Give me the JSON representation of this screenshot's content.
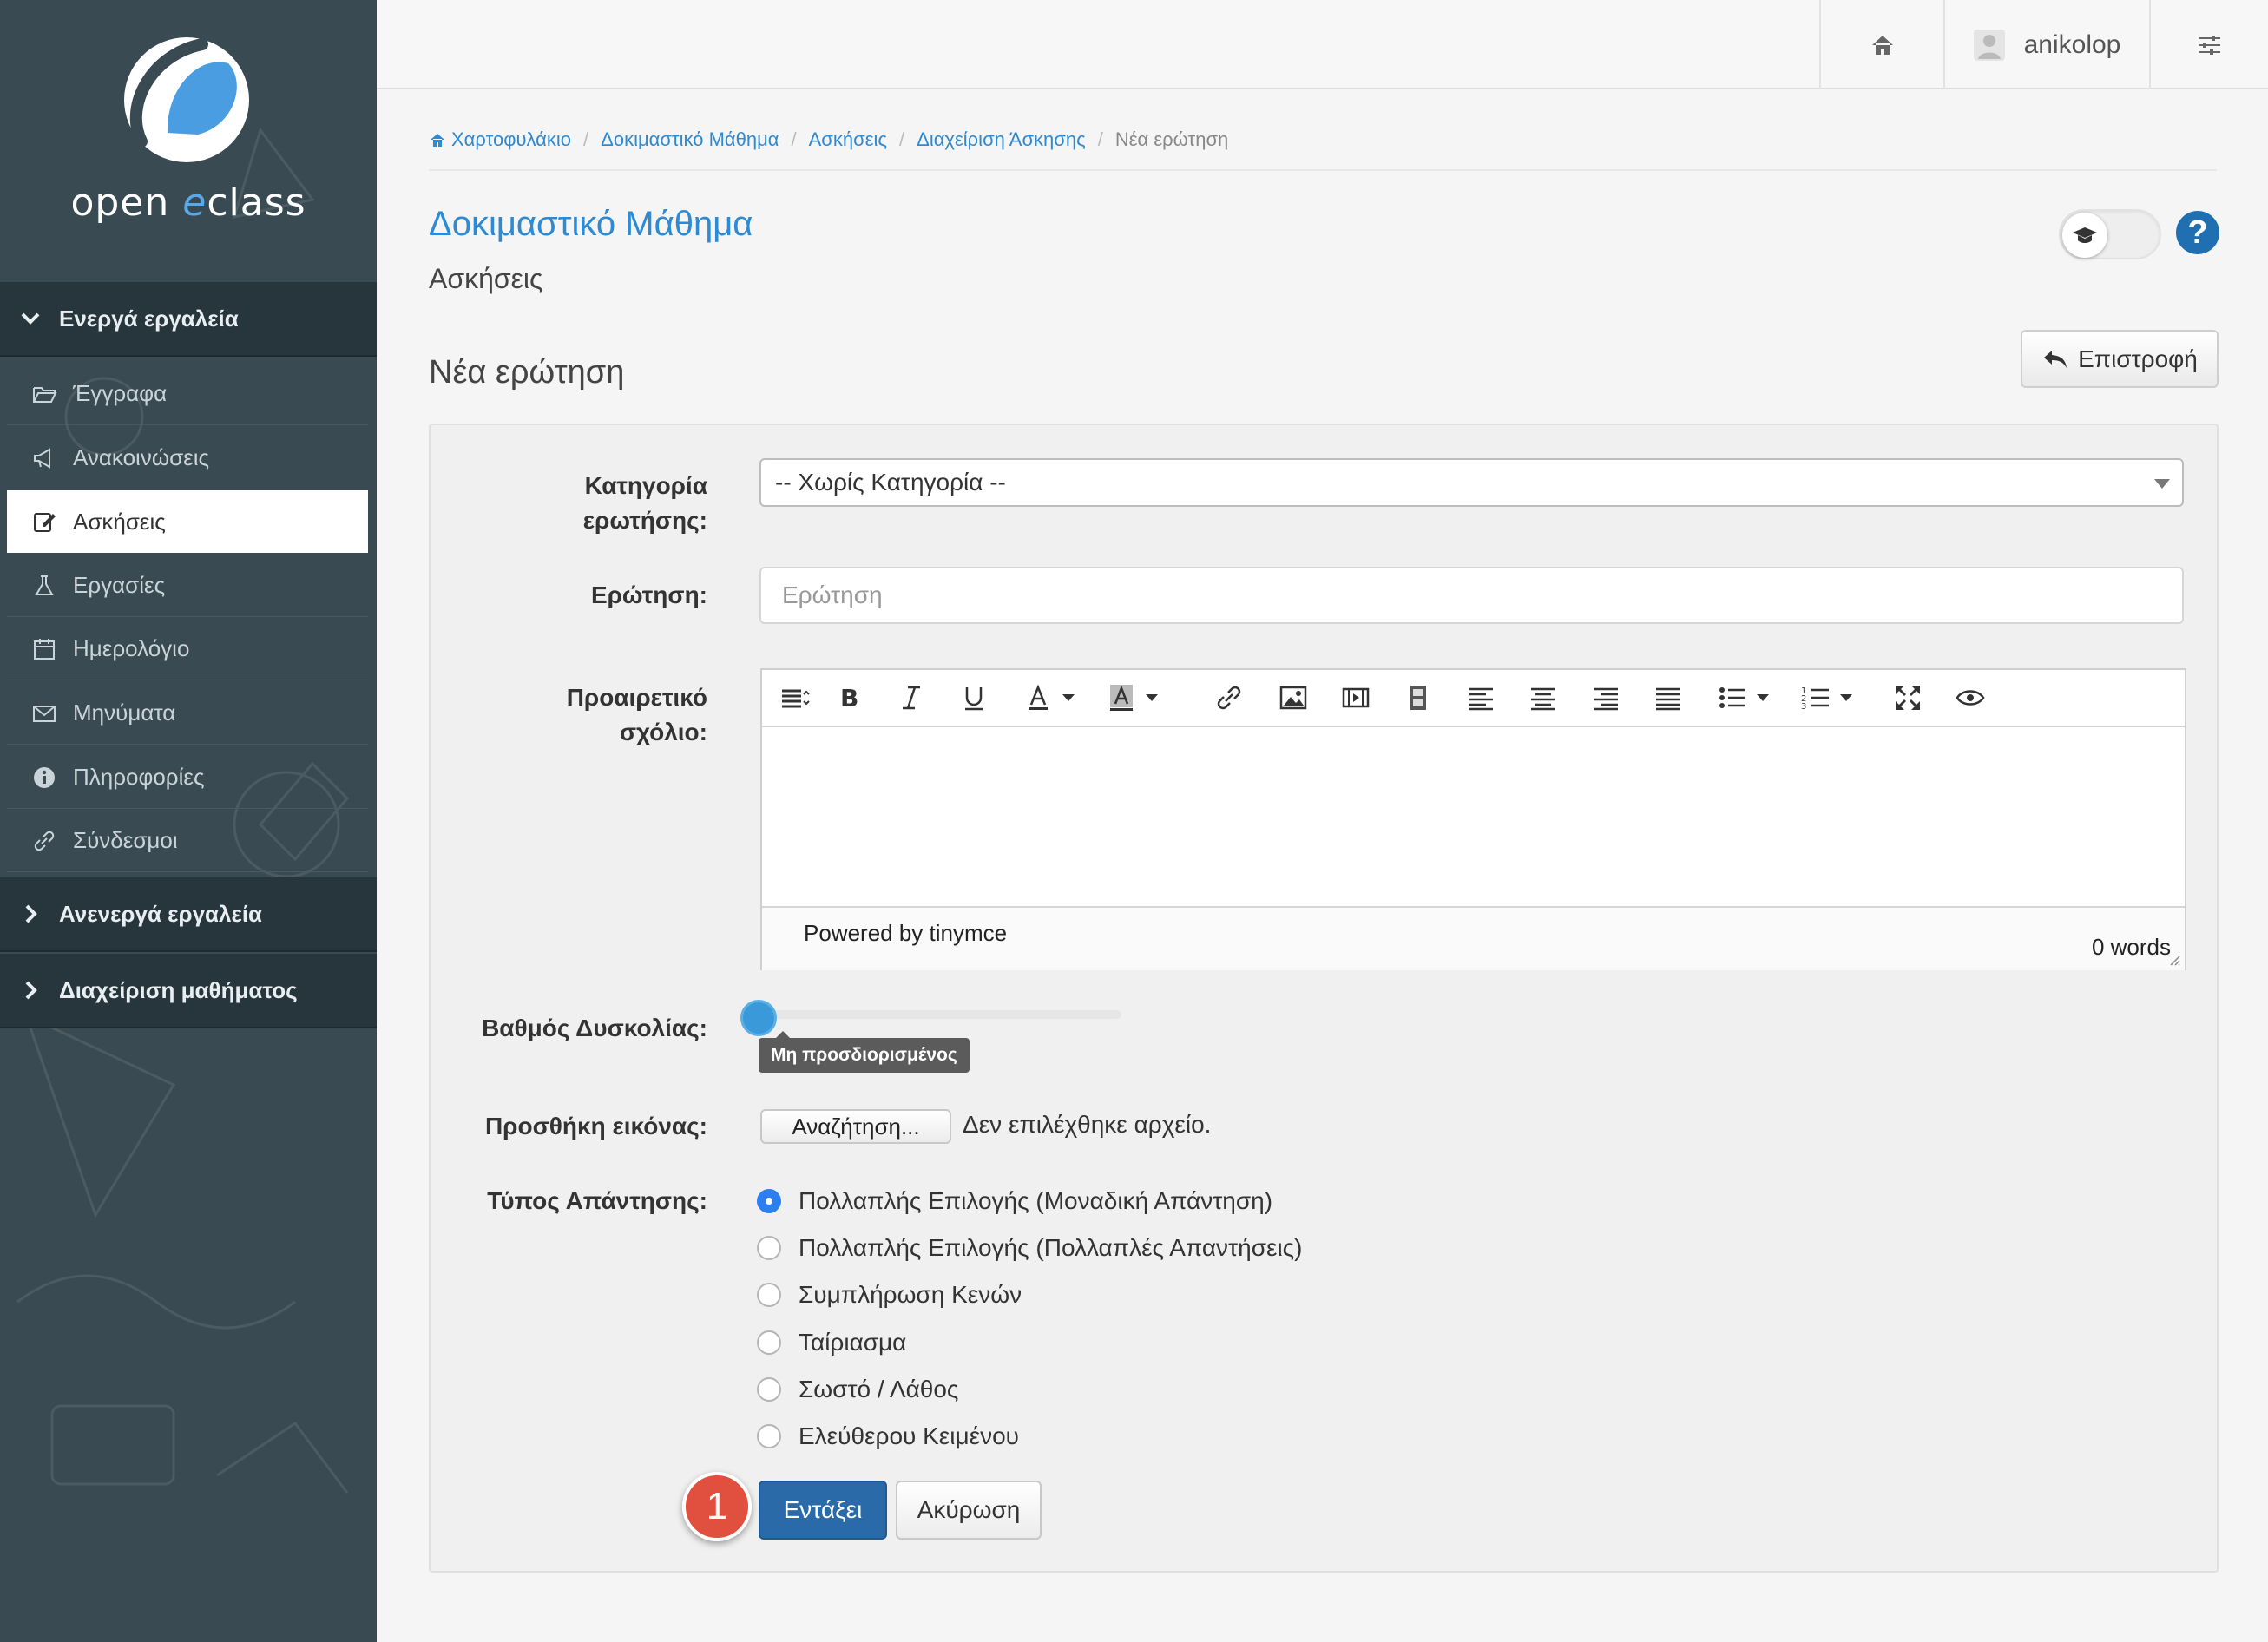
{
  "logo": {
    "word_open": "open",
    "word_e": "e",
    "word_class": "class"
  },
  "topbar": {
    "username": "anikolop"
  },
  "sidebar": {
    "active_section": "Ενεργά εργαλεία",
    "items": [
      {
        "label": "Έγγραφα",
        "icon": "folder-open-icon"
      },
      {
        "label": "Ανακοινώσεις",
        "icon": "bullhorn-icon"
      },
      {
        "label": "Ασκήσεις",
        "icon": "edit-icon",
        "active": true
      },
      {
        "label": "Εργασίες",
        "icon": "flask-icon"
      },
      {
        "label": "Ημερολόγιο",
        "icon": "calendar-icon"
      },
      {
        "label": "Μηνύματα",
        "icon": "envelope-icon"
      },
      {
        "label": "Πληροφορίες",
        "icon": "info-icon"
      },
      {
        "label": "Σύνδεσμοι",
        "icon": "link-icon"
      }
    ],
    "inactive_section": "Ανενεργά εργαλεία",
    "admin_section": "Διαχείριση μαθήματος"
  },
  "breadcrumb": {
    "items": [
      "Χαρτοφυλάκιο",
      "Δοκιμαστικό Μάθημα",
      "Ασκήσεις",
      "Διαχείριση Άσκησης"
    ],
    "current": "Νέα ερώτηση"
  },
  "course": {
    "title": "Δοκιμαστικό Μάθημα",
    "subtitle": "Ασκήσεις"
  },
  "help_label": "?",
  "page": {
    "heading": "Νέα ερώτηση",
    "back_label": "Επιστροφή"
  },
  "form": {
    "category_label_line1": "Κατηγορία",
    "category_label_line2": "ερωτήσης:",
    "category_value": "-- Χωρίς Κατηγορία --",
    "question_label": "Ερώτηση:",
    "question_placeholder": "Ερώτηση",
    "question_value": "",
    "comment_label_line1": "Προαιρετικό",
    "comment_label_line2": "σχόλιο:",
    "editor_powered": "Powered by tinymce",
    "editor_words": "0 words",
    "difficulty_label": "Βαθμός Δυσκολίας:",
    "difficulty_value": "Μη προσδιορισμένος",
    "difficulty_level": 0,
    "image_label": "Προσθήκη εικόνας:",
    "browse_label": "Αναζήτηση...",
    "no_file": "Δεν επιλέχθηκε αρχείο.",
    "answer_type_label": "Τύπος Απάντησης:",
    "answer_types": [
      {
        "label": "Πολλαπλής Επιλογής (Μοναδική Απάντηση)",
        "selected": true
      },
      {
        "label": "Πολλαπλής Επιλογής (Πολλαπλές Απαντήσεις)",
        "selected": false
      },
      {
        "label": "Συμπλήρωση Κενών",
        "selected": false
      },
      {
        "label": "Ταίριασμα",
        "selected": false
      },
      {
        "label": "Σωστό / Λάθος",
        "selected": false
      },
      {
        "label": "Ελεύθερου Κειμένου",
        "selected": false
      }
    ],
    "submit_label": "Εντάξει",
    "cancel_label": "Ακύρωση"
  },
  "annotation_badge": "1",
  "colors": {
    "accent": "#2d8ad4",
    "sidebar": "#3a4a52",
    "primary_button": "#2a6aa8",
    "badge": "#e14f3e"
  }
}
